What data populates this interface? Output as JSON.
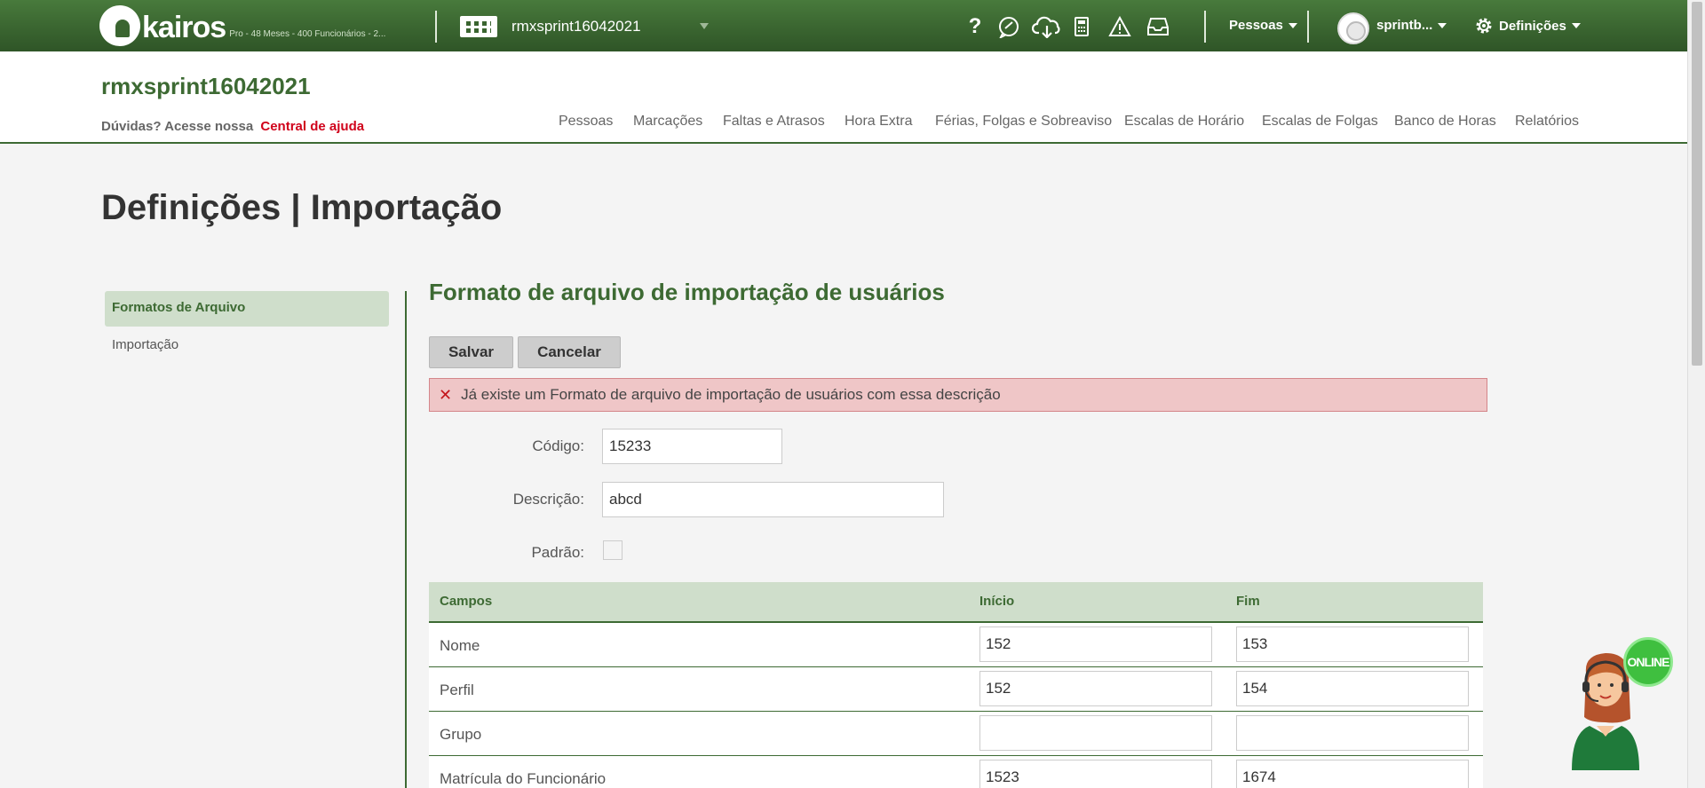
{
  "topbar": {
    "logo_text": "kairos",
    "plan_text": "Pro - 48 Meses - 400 Funcionários - 2...",
    "company_name": "rmxsprint16042021",
    "icons": [
      "help-icon",
      "chat-icon",
      "cloud-upload-icon",
      "calculator-icon",
      "warning-icon",
      "inbox-icon"
    ],
    "help_glyph": "?",
    "people_menu": "Pessoas",
    "user_name": "sprintb...",
    "settings_menu": "Definições"
  },
  "header": {
    "company_title": "rmxsprint16042021",
    "help_prefix": "Dúvidas? Acesse nossa",
    "help_link": "Central de ajuda",
    "nav": [
      "Pessoas",
      "Marcações",
      "Faltas e Atrasos",
      "Hora Extra",
      "Férias, Folgas e Sobreaviso",
      "Escalas de Horário",
      "Escalas de Folgas",
      "Banco de Horas",
      "Relatórios"
    ]
  },
  "page": {
    "title": "Definições | Importação"
  },
  "sidebar": {
    "items": [
      {
        "label": "Formatos de Arquivo",
        "active": true
      },
      {
        "label": "Importação",
        "active": false
      }
    ]
  },
  "form": {
    "section_title": "Formato de arquivo de importação de usuários",
    "save_label": "Salvar",
    "cancel_label": "Cancelar",
    "error_message": "Já existe um Formato de arquivo de importação de usuários com essa descrição",
    "codigo_label": "Código:",
    "codigo_value": "15233",
    "descricao_label": "Descrição:",
    "descricao_value": "abcd",
    "padrao_label": "Padrão:",
    "padrao_checked": false
  },
  "grid": {
    "headers": [
      "Campos",
      "Início",
      "Fim"
    ],
    "rows": [
      {
        "campo": "Nome",
        "inicio": "152",
        "fim": "153"
      },
      {
        "campo": "Perfil",
        "inicio": "152",
        "fim": "154"
      },
      {
        "campo": "Grupo",
        "inicio": "",
        "fim": ""
      },
      {
        "campo": "Matrícula do Funcionário",
        "inicio": "1523",
        "fim": "1674"
      }
    ]
  },
  "chat_widget": {
    "status": "ONLINE"
  },
  "colors": {
    "brand_green": "#3d6a33",
    "topbar_green": "#3a6530",
    "error_bg": "#efc6c7",
    "link_red": "#d0021b",
    "online_green": "#3fbf3f"
  }
}
